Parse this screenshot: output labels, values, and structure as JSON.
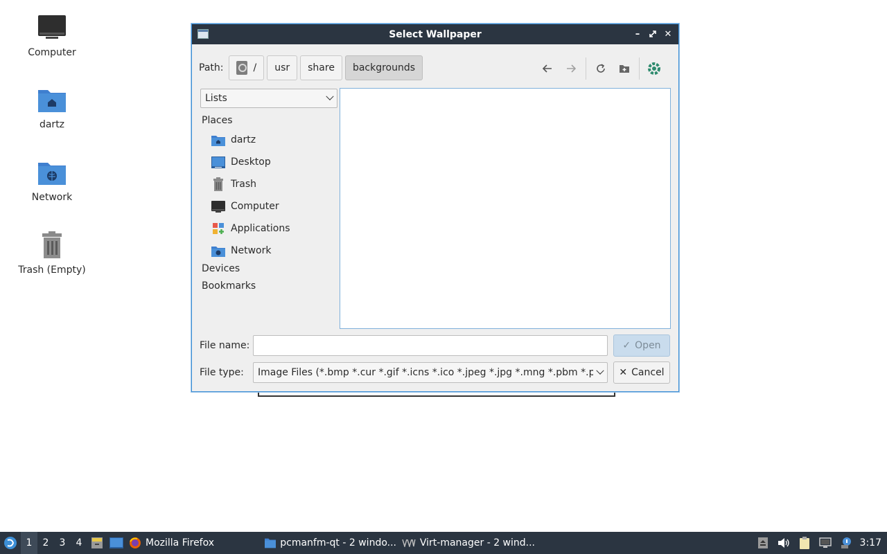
{
  "desktop": {
    "icons": [
      {
        "label": "Computer"
      },
      {
        "label": "dartz"
      },
      {
        "label": "Network"
      },
      {
        "label": "Trash (Empty)"
      }
    ]
  },
  "dialog": {
    "title": "Select Wallpaper",
    "path_label": "Path:",
    "breadcrumbs": [
      "/",
      "usr",
      "share",
      "backgrounds"
    ],
    "view_mode": "Lists",
    "sidebar": {
      "places_header": "Places",
      "places": [
        {
          "label": "dartz",
          "icon": "home-folder-icon"
        },
        {
          "label": "Desktop",
          "icon": "desktop-icon"
        },
        {
          "label": "Trash",
          "icon": "trash-icon"
        },
        {
          "label": "Computer",
          "icon": "computer-icon"
        },
        {
          "label": "Applications",
          "icon": "applications-icon"
        },
        {
          "label": "Network",
          "icon": "network-folder-icon"
        }
      ],
      "devices_header": "Devices",
      "bookmarks_header": "Bookmarks"
    },
    "file_name_label": "File name:",
    "file_name_value": "",
    "file_type_label": "File type:",
    "file_type_value": "Image Files (*.bmp *.cur *.gif *.icns *.ico *.jpeg *.jpg *.mng *.pbm *.pgm",
    "open_label": "Open",
    "cancel_label": "Cancel"
  },
  "taskbar": {
    "workspaces": [
      "1",
      "2",
      "3",
      "4"
    ],
    "active_workspace": "1",
    "tasks": [
      {
        "label": "Mozilla Firefox"
      },
      {
        "label": "pcmanfm-qt - 2 windo..."
      },
      {
        "label": "Virt-manager - 2 wind..."
      }
    ],
    "clock": "3:17"
  },
  "colors": {
    "titlebar": "#2b3541",
    "accent": "#3d8fd6",
    "folder_blue": "#4a90d9"
  }
}
